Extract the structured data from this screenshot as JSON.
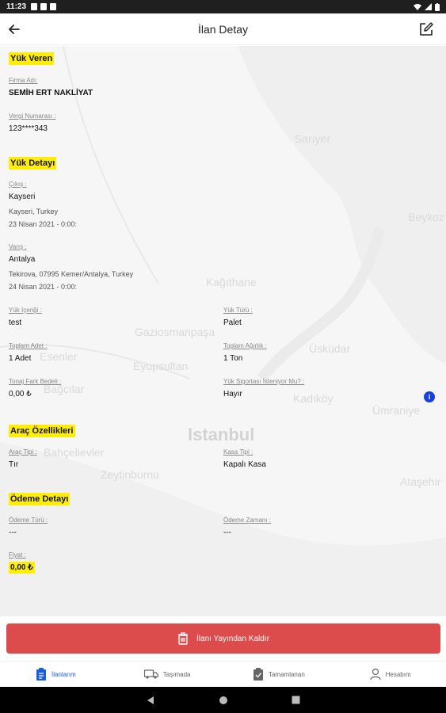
{
  "status_bar": {
    "time": "11:23"
  },
  "app_bar": {
    "title": "İlan Detay"
  },
  "map_labels": [
    "Sarıyer",
    "Beykoz",
    "Kağıthane",
    "Gaziosmanpaşa",
    "Eyupsultan",
    "Esenler",
    "Bağcılar",
    "Bahçelievler",
    "Istanbul",
    "Zeytinburnu",
    "Kadıköy",
    "Ümraniye",
    "Ataşehir",
    "Üsküdar"
  ],
  "yuk_veren": {
    "title": "Yük Veren",
    "firma_label": "Firma Adı:",
    "firma_value": "SEMİH ERT NAKLİYAT",
    "vergi_label": "Vergi Numarası :",
    "vergi_value": "123****343"
  },
  "yuk_detayi": {
    "title": "Yük Detayı",
    "cikis_label": "Çıkış :",
    "cikis_city": "Kayseri",
    "cikis_address": "Kayseri, Turkey",
    "cikis_date": "23 Nisan 2021 - 0:00:",
    "varis_label": "Varış :",
    "varis_city": "Antalya",
    "varis_address": "Tekirova, 07995 Kemer/Antalya, Turkey",
    "varis_date": "24 Nisan 2021 - 0:00:",
    "icerik_label": "Yük İçeriği :",
    "icerik_value": "test",
    "turu_label": "Yük Türü :",
    "turu_value": "Palet",
    "adet_label": "Toplam Adet :",
    "adet_value": "1 Adet",
    "agirlik_label": "Toplam Ağırlık :",
    "agirlik_value": "1 Ton",
    "tonaj_label": "Tonaj Fark Bedeli :",
    "tonaj_value": "0,00 ₺",
    "sigorta_label": "Yük Sigortası İsteniyor Mu? :",
    "sigorta_value": "Hayır"
  },
  "arac": {
    "title": "Araç Özellikleri",
    "tipi_label": "Araç Tipi :",
    "tipi_value": "Tır",
    "kasa_label": "Kasa Tipi :",
    "kasa_value": "Kapalı Kasa"
  },
  "odeme": {
    "title": "Ödeme Detayı",
    "turu_label": "Ödeme Türü :",
    "turu_value": "---",
    "zamani_label": "Ödeme Zamanı :",
    "zamani_value": "---",
    "fiyat_label": "Fiyat :",
    "fiyat_value": "0,00 ₺"
  },
  "info_badge": "i",
  "remove_button": "İlanı Yayından Kaldır",
  "bottom_nav": [
    "İlanlarım",
    "Taşımada",
    "Tamamlanan",
    "Hesabım"
  ],
  "colors": {
    "highlight": "#ffee00",
    "danger": "#dc4c4c",
    "accent": "#1a5fe0"
  }
}
